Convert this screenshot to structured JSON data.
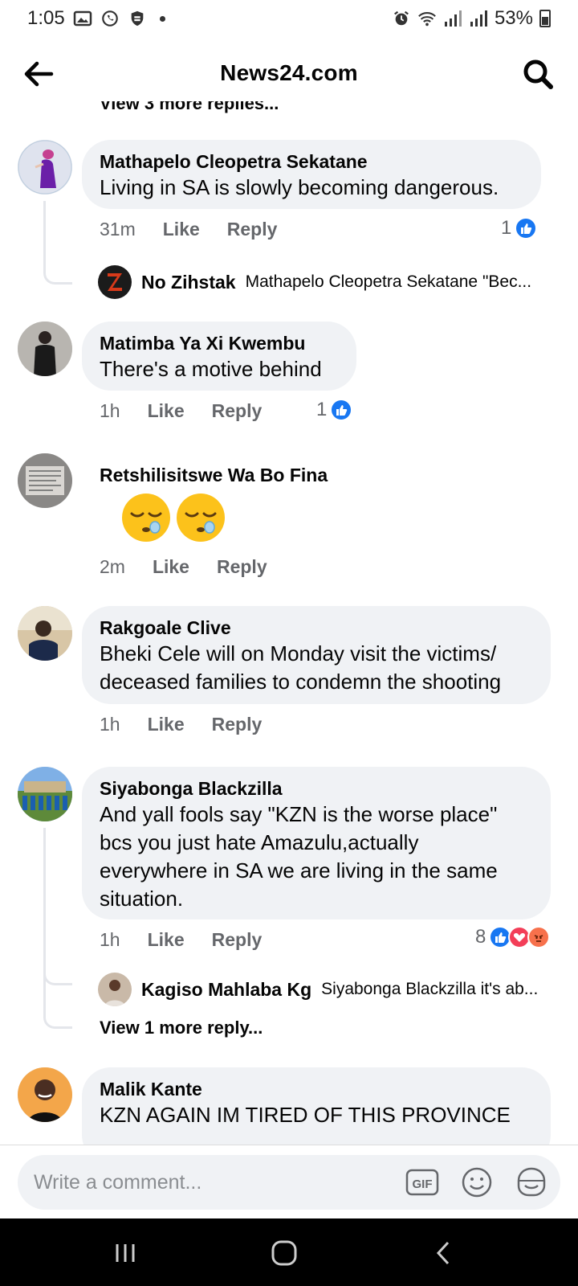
{
  "status_bar": {
    "time": "1:05",
    "battery": "53%"
  },
  "header": {
    "title": "News24.com"
  },
  "feed": {
    "clipped_text": "View 3 more replies...",
    "comments": [
      {
        "author": "Mathapelo Cleopetra Sekatane",
        "text": "Living in SA is slowly becoming dangerous.",
        "time": "31m",
        "like": "Like",
        "reply": "Reply",
        "reaction_count": "1",
        "replies": [
          {
            "author": "No Zihstak",
            "snippet": "Mathapelo Cleopetra Sekatane \"Bec..."
          }
        ]
      },
      {
        "author": "Matimba Ya Xi Kwembu",
        "text": "There's a motive behind",
        "time": "1h",
        "like": "Like",
        "reply": "Reply",
        "reaction_count": "1"
      },
      {
        "author": "Retshilisitswe Wa Bo Fina",
        "emoji": [
          "sleepy-face",
          "sleepy-face"
        ],
        "time": "2m",
        "like": "Like",
        "reply": "Reply"
      },
      {
        "author": "Rakgoale Clive",
        "text_lines": [
          "Bheki Cele will on Monday visit the victims/",
          "deceased families to condemn the shooting"
        ],
        "time": "1h",
        "like": "Like",
        "reply": "Reply"
      },
      {
        "author": "Siyabonga Blackzilla",
        "text_lines": [
          "And yall fools say \"KZN is the worse place\"",
          "bcs you just hate Amazulu,actually",
          "everywhere in SA we are living in the same",
          "situation."
        ],
        "time": "1h",
        "like": "Like",
        "reply": "Reply",
        "reaction_count": "8",
        "reactions": [
          "like",
          "love",
          "angry"
        ],
        "replies": [
          {
            "author": "Kagiso Mahlaba Kg",
            "snippet": "Siyabonga Blackzilla it's ab..."
          }
        ],
        "view_more": "View 1 more reply..."
      },
      {
        "author": "Malik Kante",
        "text": "KZN AGAIN IM TIRED OF THIS PROVINCE"
      }
    ]
  },
  "composer": {
    "placeholder": "Write a comment...",
    "icons": [
      "gif-icon",
      "emoji-icon",
      "sticker-icon"
    ]
  },
  "colors": {
    "accent": "#1877f2",
    "bubble": "#f0f2f5",
    "meta": "#65676b",
    "love": "#f33e58",
    "angry": "#f7714c"
  }
}
